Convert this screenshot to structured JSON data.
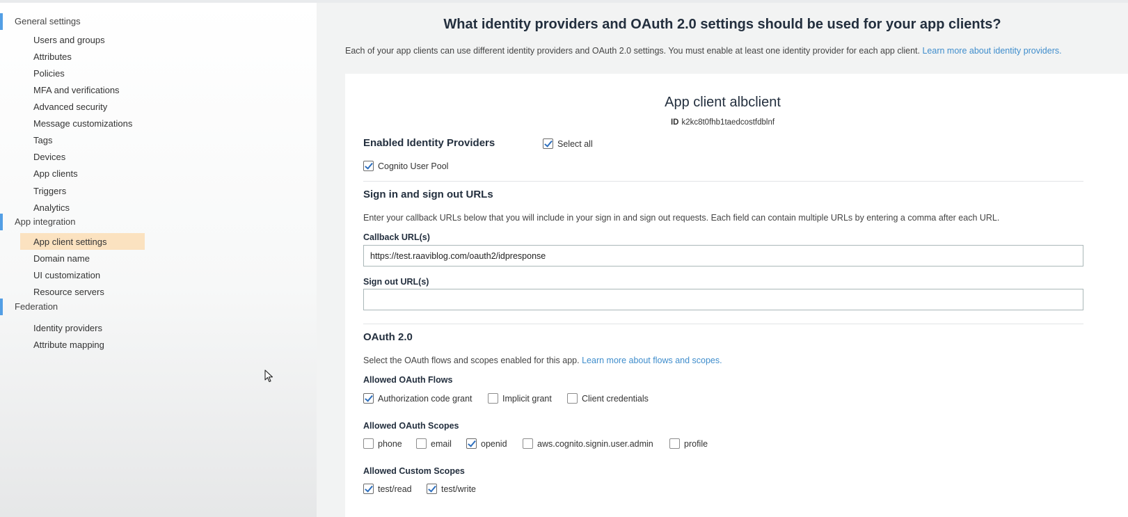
{
  "sidebar": {
    "groups": [
      {
        "label": "General settings",
        "items": [
          "Users and groups",
          "Attributes",
          "Policies",
          "MFA and verifications",
          "Advanced security",
          "Message customizations",
          "Tags",
          "Devices",
          "App clients",
          "Triggers",
          "Analytics"
        ]
      },
      {
        "label": "App integration",
        "items": [
          "App client settings",
          "Domain name",
          "UI customization",
          "Resource servers"
        ]
      },
      {
        "label": "Federation",
        "items": [
          "Identity providers",
          "Attribute mapping"
        ]
      }
    ],
    "active_item": "App client settings"
  },
  "main": {
    "title": "What identity providers and OAuth 2.0 settings should be used for your app clients?",
    "intro": "Each of your app clients can use different identity providers and OAuth 2.0 settings. You must enable at least one identity provider for each app client.",
    "intro_link": "Learn more about identity providers."
  },
  "client": {
    "name": "App client albclient",
    "id_label": "ID",
    "id_value": "k2kc8t0fhb1taedcostfdblnf"
  },
  "identity_providers": {
    "heading": "Enabled Identity Providers",
    "select_all": {
      "label": "Select all",
      "checked": true
    },
    "providers": [
      {
        "label": "Cognito User Pool",
        "checked": true
      }
    ]
  },
  "urls": {
    "heading": "Sign in and sign out URLs",
    "description": "Enter your callback URLs below that you will include in your sign in and sign out requests. Each field can contain multiple URLs by entering a comma after each URL.",
    "callback_label": "Callback URL(s)",
    "callback_value": "https://test.raaviblog.com/oauth2/idpresponse",
    "signout_label": "Sign out URL(s)",
    "signout_value": ""
  },
  "oauth": {
    "heading": "OAuth 2.0",
    "description": "Select the OAuth flows and scopes enabled for this app.",
    "description_link": "Learn more about flows and scopes.",
    "flows_label": "Allowed OAuth Flows",
    "flows": [
      {
        "label": "Authorization code grant",
        "checked": true
      },
      {
        "label": "Implicit grant",
        "checked": false
      },
      {
        "label": "Client credentials",
        "checked": false
      }
    ],
    "scopes_label": "Allowed OAuth Scopes",
    "scopes": [
      {
        "label": "phone",
        "checked": false
      },
      {
        "label": "email",
        "checked": false
      },
      {
        "label": "openid",
        "checked": true
      },
      {
        "label": "aws.cognito.signin.user.admin",
        "checked": false
      },
      {
        "label": "profile",
        "checked": false
      }
    ],
    "custom_scopes_label": "Allowed Custom Scopes",
    "custom_scopes": [
      {
        "label": "test/read",
        "checked": true
      },
      {
        "label": "test/write",
        "checked": true
      }
    ]
  },
  "colors": {
    "accent": "#539fe5",
    "active_item_bg": "#fbe2c0",
    "link": "#3f8dcc",
    "checkmark": "#2e6fbd"
  }
}
